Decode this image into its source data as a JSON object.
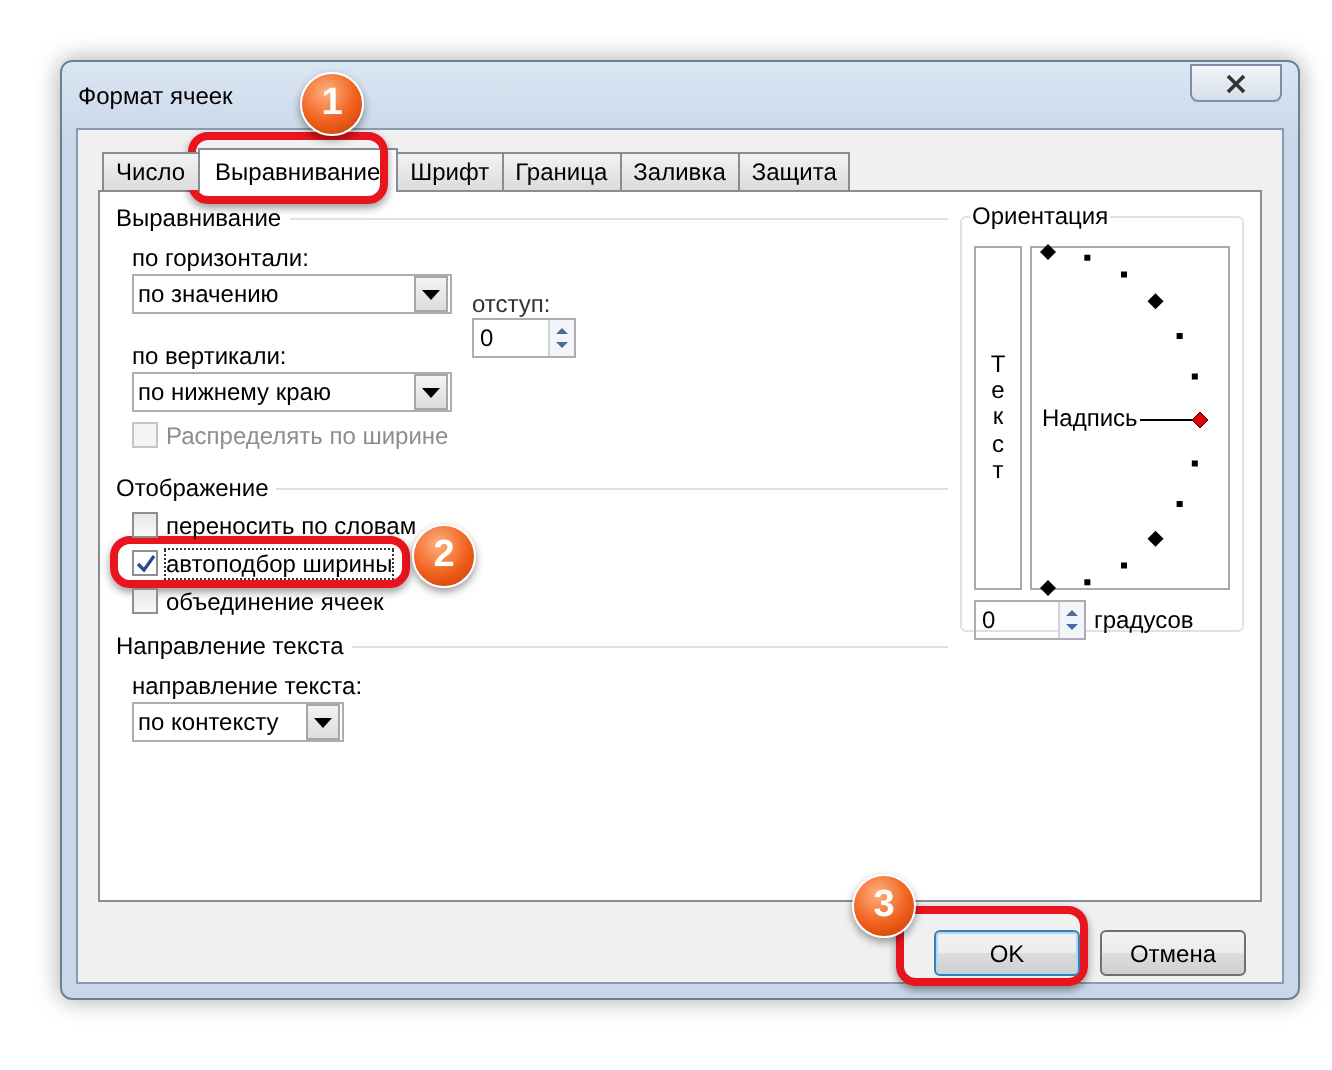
{
  "window": {
    "title": "Формат ячеек"
  },
  "tabs": [
    {
      "label": "Число",
      "selected": false
    },
    {
      "label": "Выравнивание",
      "selected": true
    },
    {
      "label": "Шрифт",
      "selected": false
    },
    {
      "label": "Граница",
      "selected": false
    },
    {
      "label": "Заливка",
      "selected": false
    },
    {
      "label": "Защита",
      "selected": false
    }
  ],
  "alignment": {
    "title": "Выравнивание",
    "horizontal": {
      "label": "по горизонтали:",
      "value": "по значению"
    },
    "indent": {
      "label": "отступ:",
      "value": "0"
    },
    "vertical": {
      "label": "по вертикали:",
      "value": "по нижнему краю"
    },
    "distribute": {
      "label": "Распределять по ширине",
      "checked": false,
      "disabled": true
    }
  },
  "display": {
    "title": "Отображение",
    "options": [
      {
        "label": "переносить по словам",
        "checked": false
      },
      {
        "label": "автоподбор ширины",
        "checked": true
      },
      {
        "label": "объединение ячеек",
        "checked": false
      }
    ]
  },
  "direction": {
    "title": "Направление текста",
    "label": "направление текста:",
    "value": "по контексту"
  },
  "orientation": {
    "title": "Ориентация",
    "vertical_text": "Текст",
    "dial_label": "Надпись",
    "degrees": {
      "value": "0",
      "label": "градусов"
    }
  },
  "buttons": [
    {
      "label": "OK",
      "kind": "default"
    },
    {
      "label": "Отмена",
      "kind": "normal"
    }
  ],
  "callouts": [
    {
      "number": "1"
    },
    {
      "number": "2"
    },
    {
      "number": "3"
    }
  ]
}
